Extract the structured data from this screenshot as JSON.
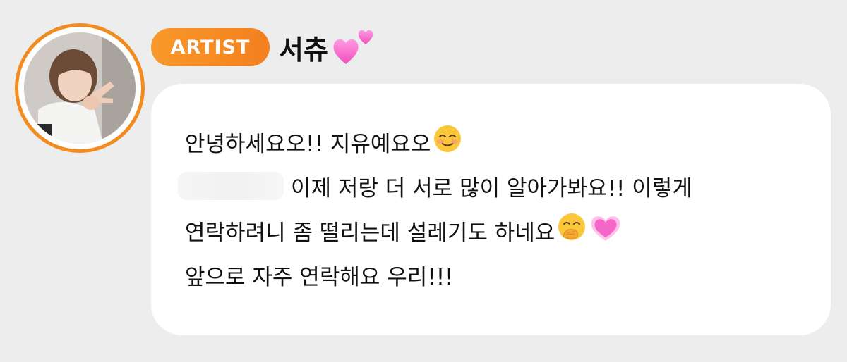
{
  "header": {
    "badge_label": "ARTIST",
    "sender_name": "서츄"
  },
  "icons": {
    "avatar": "profile-photo",
    "name_decoration": "two-hearts-emoji",
    "line1_emoji": "smiling-blush-emoji",
    "line3_emoji_1": "face-with-hand-over-mouth-emoji",
    "line3_emoji_2": "growing-heart-emoji"
  },
  "colors": {
    "background": "#ededee",
    "accent_orange": "#f47f1f",
    "bubble": "#ffffff",
    "text": "#111111",
    "heart_pink": "#f466c8"
  },
  "message": {
    "line1": "안녕하세요오!! 지유예요오",
    "line2": "이제 저랑 더 서로 많이 알아가봐요!! 이렇게",
    "line3": "연락하려니 좀 떨리는데 설레기도 하네요",
    "line4": "앞으로 자주 연락해요 우리!!!"
  }
}
